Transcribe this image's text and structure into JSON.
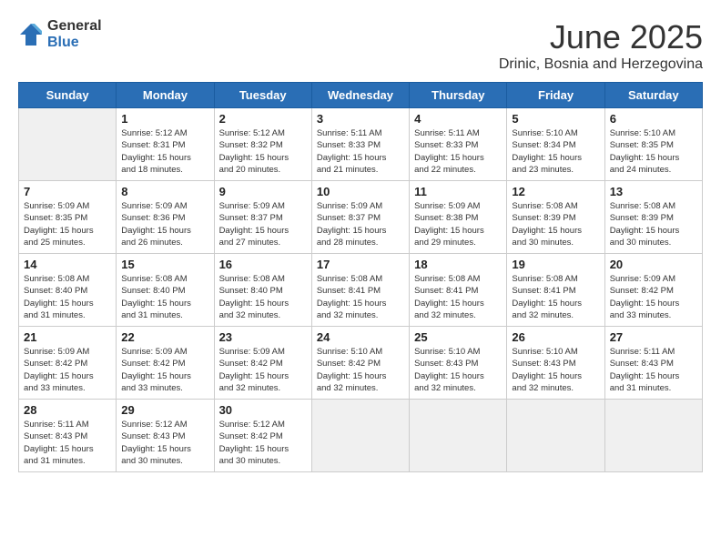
{
  "header": {
    "logo_general": "General",
    "logo_blue": "Blue",
    "title": "June 2025",
    "subtitle": "Drinic, Bosnia and Herzegovina"
  },
  "weekdays": [
    "Sunday",
    "Monday",
    "Tuesday",
    "Wednesday",
    "Thursday",
    "Friday",
    "Saturday"
  ],
  "days": [
    {
      "num": "",
      "info": ""
    },
    {
      "num": "1",
      "info": "Sunrise: 5:12 AM\nSunset: 8:31 PM\nDaylight: 15 hours\nand 18 minutes."
    },
    {
      "num": "2",
      "info": "Sunrise: 5:12 AM\nSunset: 8:32 PM\nDaylight: 15 hours\nand 20 minutes."
    },
    {
      "num": "3",
      "info": "Sunrise: 5:11 AM\nSunset: 8:33 PM\nDaylight: 15 hours\nand 21 minutes."
    },
    {
      "num": "4",
      "info": "Sunrise: 5:11 AM\nSunset: 8:33 PM\nDaylight: 15 hours\nand 22 minutes."
    },
    {
      "num": "5",
      "info": "Sunrise: 5:10 AM\nSunset: 8:34 PM\nDaylight: 15 hours\nand 23 minutes."
    },
    {
      "num": "6",
      "info": "Sunrise: 5:10 AM\nSunset: 8:35 PM\nDaylight: 15 hours\nand 24 minutes."
    },
    {
      "num": "7",
      "info": "Sunrise: 5:09 AM\nSunset: 8:35 PM\nDaylight: 15 hours\nand 25 minutes."
    },
    {
      "num": "8",
      "info": "Sunrise: 5:09 AM\nSunset: 8:36 PM\nDaylight: 15 hours\nand 26 minutes."
    },
    {
      "num": "9",
      "info": "Sunrise: 5:09 AM\nSunset: 8:37 PM\nDaylight: 15 hours\nand 27 minutes."
    },
    {
      "num": "10",
      "info": "Sunrise: 5:09 AM\nSunset: 8:37 PM\nDaylight: 15 hours\nand 28 minutes."
    },
    {
      "num": "11",
      "info": "Sunrise: 5:09 AM\nSunset: 8:38 PM\nDaylight: 15 hours\nand 29 minutes."
    },
    {
      "num": "12",
      "info": "Sunrise: 5:08 AM\nSunset: 8:39 PM\nDaylight: 15 hours\nand 30 minutes."
    },
    {
      "num": "13",
      "info": "Sunrise: 5:08 AM\nSunset: 8:39 PM\nDaylight: 15 hours\nand 30 minutes."
    },
    {
      "num": "14",
      "info": "Sunrise: 5:08 AM\nSunset: 8:40 PM\nDaylight: 15 hours\nand 31 minutes."
    },
    {
      "num": "15",
      "info": "Sunrise: 5:08 AM\nSunset: 8:40 PM\nDaylight: 15 hours\nand 31 minutes."
    },
    {
      "num": "16",
      "info": "Sunrise: 5:08 AM\nSunset: 8:40 PM\nDaylight: 15 hours\nand 32 minutes."
    },
    {
      "num": "17",
      "info": "Sunrise: 5:08 AM\nSunset: 8:41 PM\nDaylight: 15 hours\nand 32 minutes."
    },
    {
      "num": "18",
      "info": "Sunrise: 5:08 AM\nSunset: 8:41 PM\nDaylight: 15 hours\nand 32 minutes."
    },
    {
      "num": "19",
      "info": "Sunrise: 5:08 AM\nSunset: 8:41 PM\nDaylight: 15 hours\nand 32 minutes."
    },
    {
      "num": "20",
      "info": "Sunrise: 5:09 AM\nSunset: 8:42 PM\nDaylight: 15 hours\nand 33 minutes."
    },
    {
      "num": "21",
      "info": "Sunrise: 5:09 AM\nSunset: 8:42 PM\nDaylight: 15 hours\nand 33 minutes."
    },
    {
      "num": "22",
      "info": "Sunrise: 5:09 AM\nSunset: 8:42 PM\nDaylight: 15 hours\nand 33 minutes."
    },
    {
      "num": "23",
      "info": "Sunrise: 5:09 AM\nSunset: 8:42 PM\nDaylight: 15 hours\nand 32 minutes."
    },
    {
      "num": "24",
      "info": "Sunrise: 5:10 AM\nSunset: 8:42 PM\nDaylight: 15 hours\nand 32 minutes."
    },
    {
      "num": "25",
      "info": "Sunrise: 5:10 AM\nSunset: 8:43 PM\nDaylight: 15 hours\nand 32 minutes."
    },
    {
      "num": "26",
      "info": "Sunrise: 5:10 AM\nSunset: 8:43 PM\nDaylight: 15 hours\nand 32 minutes."
    },
    {
      "num": "27",
      "info": "Sunrise: 5:11 AM\nSunset: 8:43 PM\nDaylight: 15 hours\nand 31 minutes."
    },
    {
      "num": "28",
      "info": "Sunrise: 5:11 AM\nSunset: 8:43 PM\nDaylight: 15 hours\nand 31 minutes."
    },
    {
      "num": "29",
      "info": "Sunrise: 5:12 AM\nSunset: 8:43 PM\nDaylight: 15 hours\nand 30 minutes."
    },
    {
      "num": "30",
      "info": "Sunrise: 5:12 AM\nSunset: 8:42 PM\nDaylight: 15 hours\nand 30 minutes."
    },
    {
      "num": "",
      "info": ""
    },
    {
      "num": "",
      "info": ""
    },
    {
      "num": "",
      "info": ""
    },
    {
      "num": "",
      "info": ""
    },
    {
      "num": "",
      "info": ""
    }
  ]
}
